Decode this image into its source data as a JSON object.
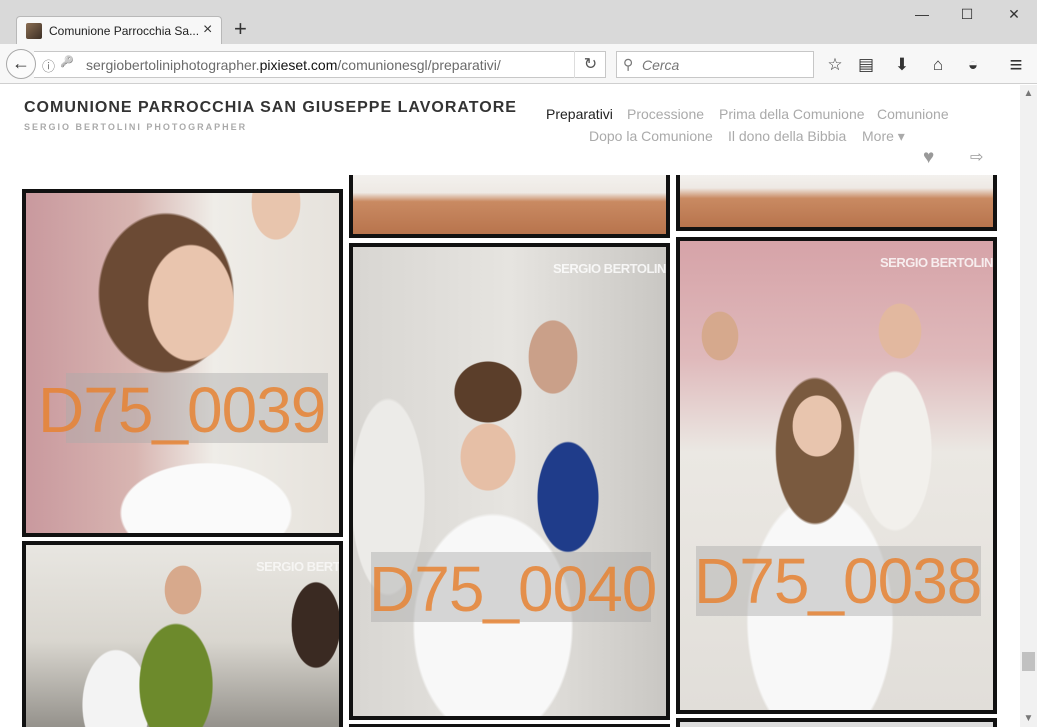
{
  "browser": {
    "tab_title": "Comunione Parrocchia Sa...",
    "url_prefix": "sergiobertoliniphotographer.",
    "url_domain": "pixieset.com",
    "url_path": "/comunionesgl/preparativi/",
    "search_placeholder": "Cerca",
    "icons": {
      "back": "←",
      "info": "ⓘ",
      "key": "🔑",
      "reload": "↻",
      "search": "⚲",
      "bookmark": "☆",
      "reading_list": "▤",
      "download": "⬇",
      "home": "⌂",
      "pocket": "◒",
      "menu": "≡",
      "minimize": "—",
      "maximize": "☐",
      "close": "✕",
      "tab_close": "×",
      "new_tab": "+"
    }
  },
  "site": {
    "title": "COMUNIONE PARROCCHIA SAN GIUSEPPE LAVORATORE",
    "subtitle": "SERGIO BERTOLINI PHOTOGRAPHER",
    "nav": [
      {
        "label": "Preparativi",
        "active": true
      },
      {
        "label": "Processione"
      },
      {
        "label": "Prima della Comunione"
      },
      {
        "label": "Comunione"
      },
      {
        "label": "Dopo la Comunione"
      },
      {
        "label": "Il dono della Bibbia"
      },
      {
        "label": "More ▾"
      }
    ],
    "heart_icon": "♥",
    "logout_icon": "⇨"
  },
  "photos": [
    {
      "id": "D75_0039"
    },
    {
      "id": "D75_0040"
    },
    {
      "id": "D75_0038"
    }
  ],
  "logo_text": "SERGIO BERTOLINI",
  "colors": {
    "watermark": "#e68232",
    "photo_border": "#111111",
    "nav_active": "#222222",
    "nav_inactive": "#aaaaaa"
  }
}
